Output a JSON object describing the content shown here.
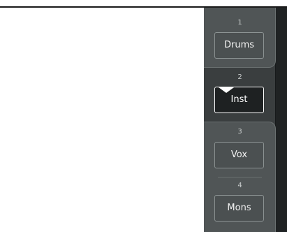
{
  "tabs": [
    {
      "number": "1",
      "label": "Drums",
      "selected": false
    },
    {
      "number": "2",
      "label": "Inst",
      "selected": true
    },
    {
      "number": "3",
      "label": "Vox",
      "selected": false
    },
    {
      "number": "4",
      "label": "Mons",
      "selected": false
    }
  ],
  "colors": {
    "panel": "#3a3e3f",
    "group": "#505556",
    "selected_button": "#1e2122",
    "text": "#f2f2f2"
  }
}
